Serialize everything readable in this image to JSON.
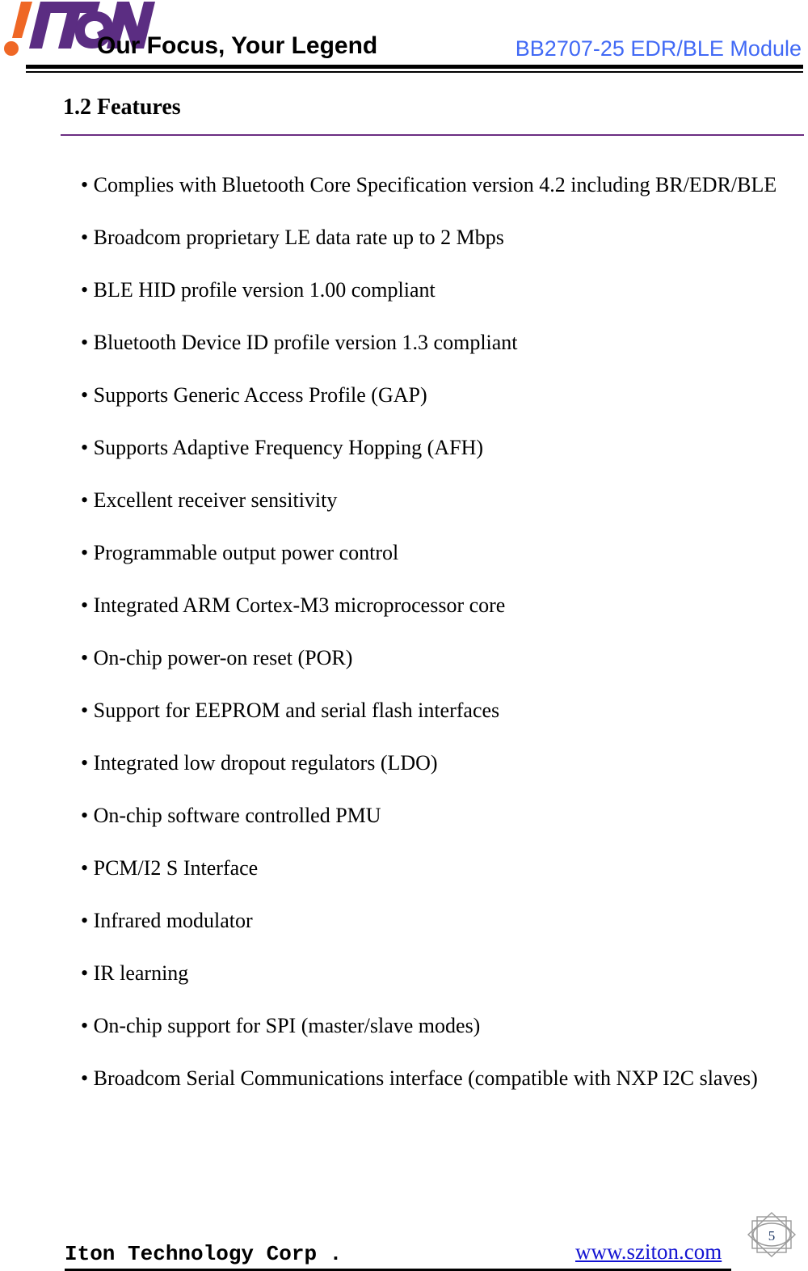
{
  "header": {
    "logo_alt": "ITON",
    "logo_mark": "!",
    "logo_text": "ITON",
    "slogan": "Our Focus, Your Legend",
    "product": "BB2707-25 EDR/BLE Module",
    "product_color": "#4169f5"
  },
  "section": {
    "number": "1.2",
    "title": "1.2 Features",
    "rule_color": "#6b2d82"
  },
  "features": {
    "bullet": "•",
    "items": [
      {
        "text": "• Complies with Bluetooth Core Specification version 4.2 including BR/EDR/BLE",
        "style": "justified"
      },
      {
        "text": "• Broadcom proprietary LE data rate up to 2 Mbps",
        "style": "plain"
      },
      {
        "text": "• BLE HID profile version 1.00 compliant",
        "style": "plain"
      },
      {
        "text": "• Bluetooth Device ID profile version 1.3 compliant",
        "style": "plain"
      },
      {
        "text": "• Supports Generic Access Profile (GAP)",
        "style": "plain"
      },
      {
        "text": "• Supports Adaptive Frequency Hopping (AFH)",
        "style": "plain"
      },
      {
        "text": "• Excellent receiver sensitivity",
        "style": "plain"
      },
      {
        "text": "• Programmable output power control",
        "style": "plain"
      },
      {
        "text": "• Integrated ARM Cortex-M3 microprocessor core",
        "style": "plain"
      },
      {
        "text": "• On-chip power-on reset (POR)",
        "style": "plain"
      },
      {
        "text": "• Support for EEPROM and serial flash interfaces",
        "style": "plain"
      },
      {
        "text": "• Integrated low dropout regulators (LDO)",
        "style": "plain"
      },
      {
        "text": "• On-chip software controlled PMU",
        "style": "plain"
      },
      {
        "text": "• PCM/I2 S Interface",
        "style": "plain"
      },
      {
        "text": "• Infrared modulator",
        "style": "plain"
      },
      {
        "text": "• IR learning",
        "style": "plain"
      },
      {
        "text": "• On-chip support for SPI (master/slave modes)",
        "style": "plain"
      },
      {
        "text": "• Broadcom Serial Communications interface (compatible with NXP I2C slaves)",
        "style": "justified"
      }
    ]
  },
  "footer": {
    "company": "Iton Technology Corp .",
    "website": "www.sziton.com",
    "website_color": "#1414d2",
    "page_number": "5"
  }
}
